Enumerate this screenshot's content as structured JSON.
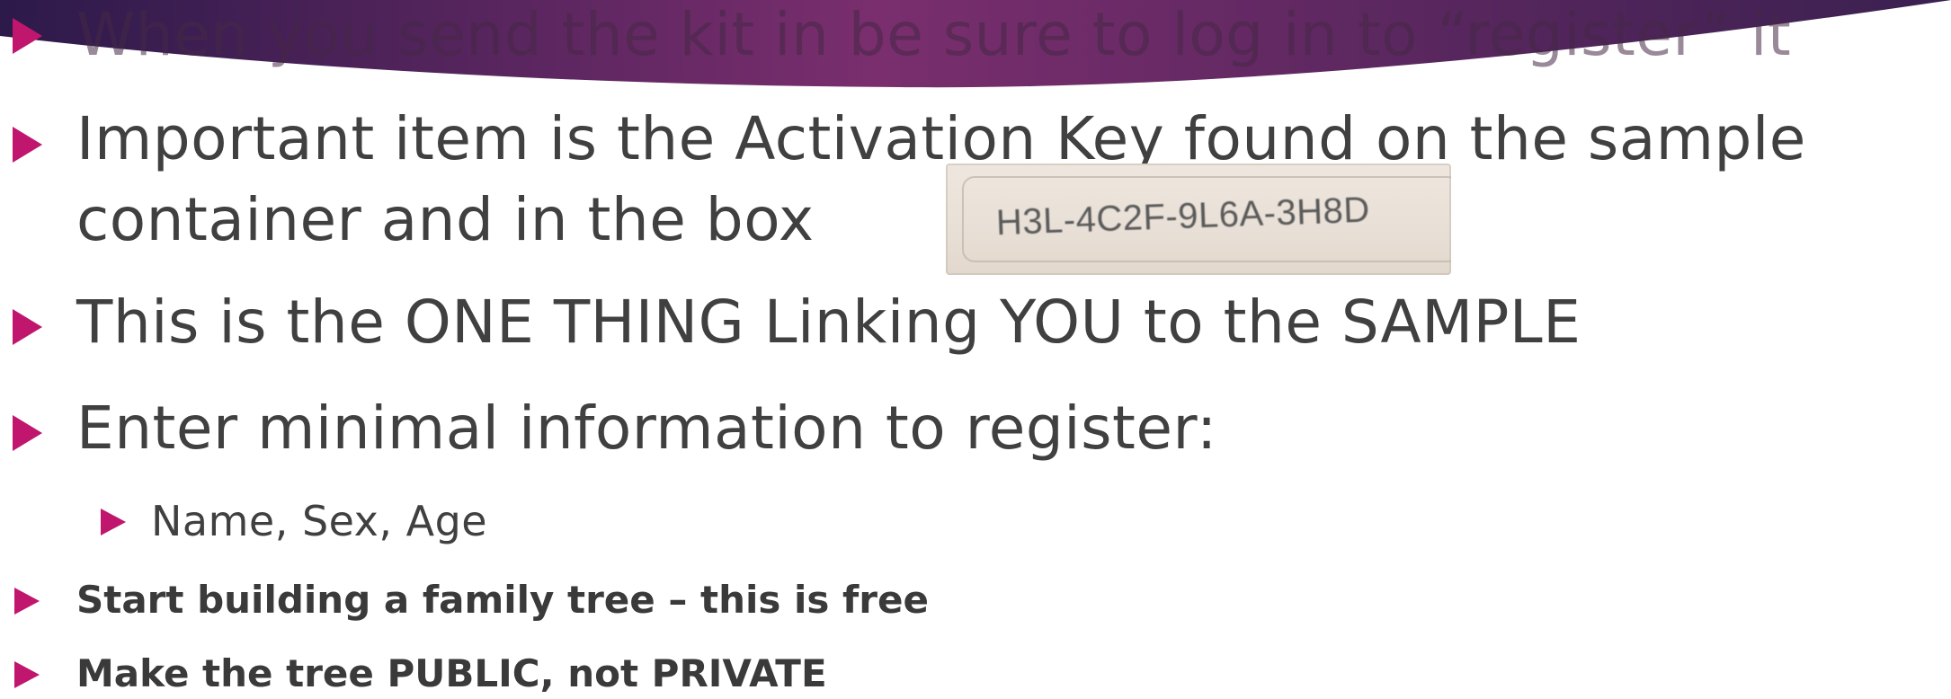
{
  "banner": {
    "colors": {
      "left": "#2c1a4a",
      "mid": "#7a2e6e",
      "right": "#3a2050"
    }
  },
  "slide": {
    "bullet_color": "#c0166e",
    "text_color": "#404040",
    "bullets": [
      {
        "text": "When you send the kit in be sure to log in to “register” it"
      },
      {
        "line1": "Important item is the Activation Key found on the sample",
        "line2": "container and in the box"
      },
      {
        "text": "This is the ONE THING Linking YOU to the SAMPLE"
      },
      {
        "text": "Enter minimal information to register:"
      },
      {
        "text": "Name, Sex, Age"
      },
      {
        "text": "Start building a family tree – this is free"
      },
      {
        "text": "Make the tree PUBLIC, not PRIVATE"
      }
    ]
  },
  "activation_key_photo": {
    "code": "H3L-4C2F-9L6A-3H8D"
  }
}
